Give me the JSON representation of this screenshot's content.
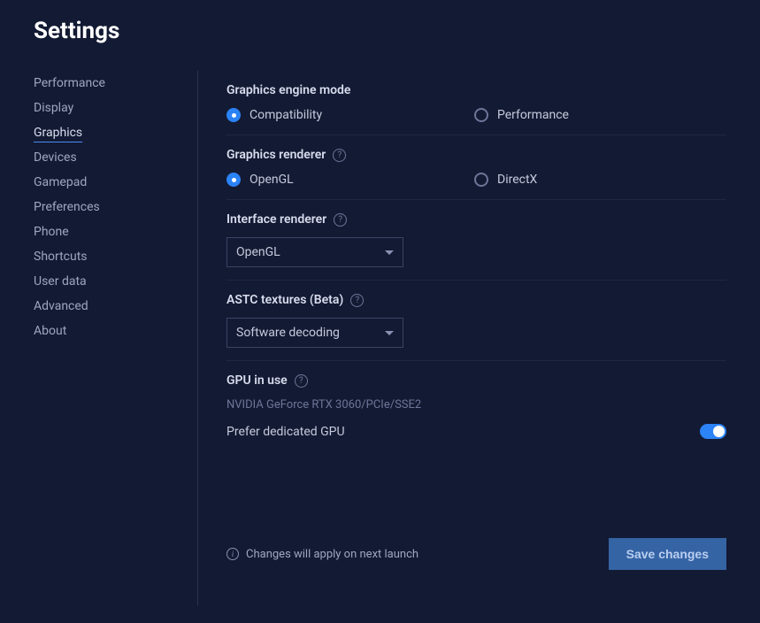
{
  "page_title": "Settings",
  "sidebar": {
    "items": [
      {
        "label": "Performance"
      },
      {
        "label": "Display"
      },
      {
        "label": "Graphics"
      },
      {
        "label": "Devices"
      },
      {
        "label": "Gamepad"
      },
      {
        "label": "Preferences"
      },
      {
        "label": "Phone"
      },
      {
        "label": "Shortcuts"
      },
      {
        "label": "User data"
      },
      {
        "label": "Advanced"
      },
      {
        "label": "About"
      }
    ],
    "active_index": 2
  },
  "graphics_engine": {
    "label": "Graphics engine mode",
    "options": [
      {
        "label": "Compatibility"
      },
      {
        "label": "Performance"
      }
    ],
    "selected_index": 0
  },
  "graphics_renderer": {
    "label": "Graphics renderer",
    "options": [
      {
        "label": "OpenGL"
      },
      {
        "label": "DirectX"
      }
    ],
    "selected_index": 0
  },
  "interface_renderer": {
    "label": "Interface renderer",
    "selected": "OpenGL"
  },
  "astc": {
    "label": "ASTC textures (Beta)",
    "selected": "Software decoding"
  },
  "gpu": {
    "label": "GPU in use",
    "value": "NVIDIA GeForce RTX 3060/PCIe/SSE2",
    "prefer_label": "Prefer dedicated GPU",
    "prefer_on": true
  },
  "footer": {
    "message": "Changes will apply on next launch",
    "save_label": "Save changes"
  }
}
